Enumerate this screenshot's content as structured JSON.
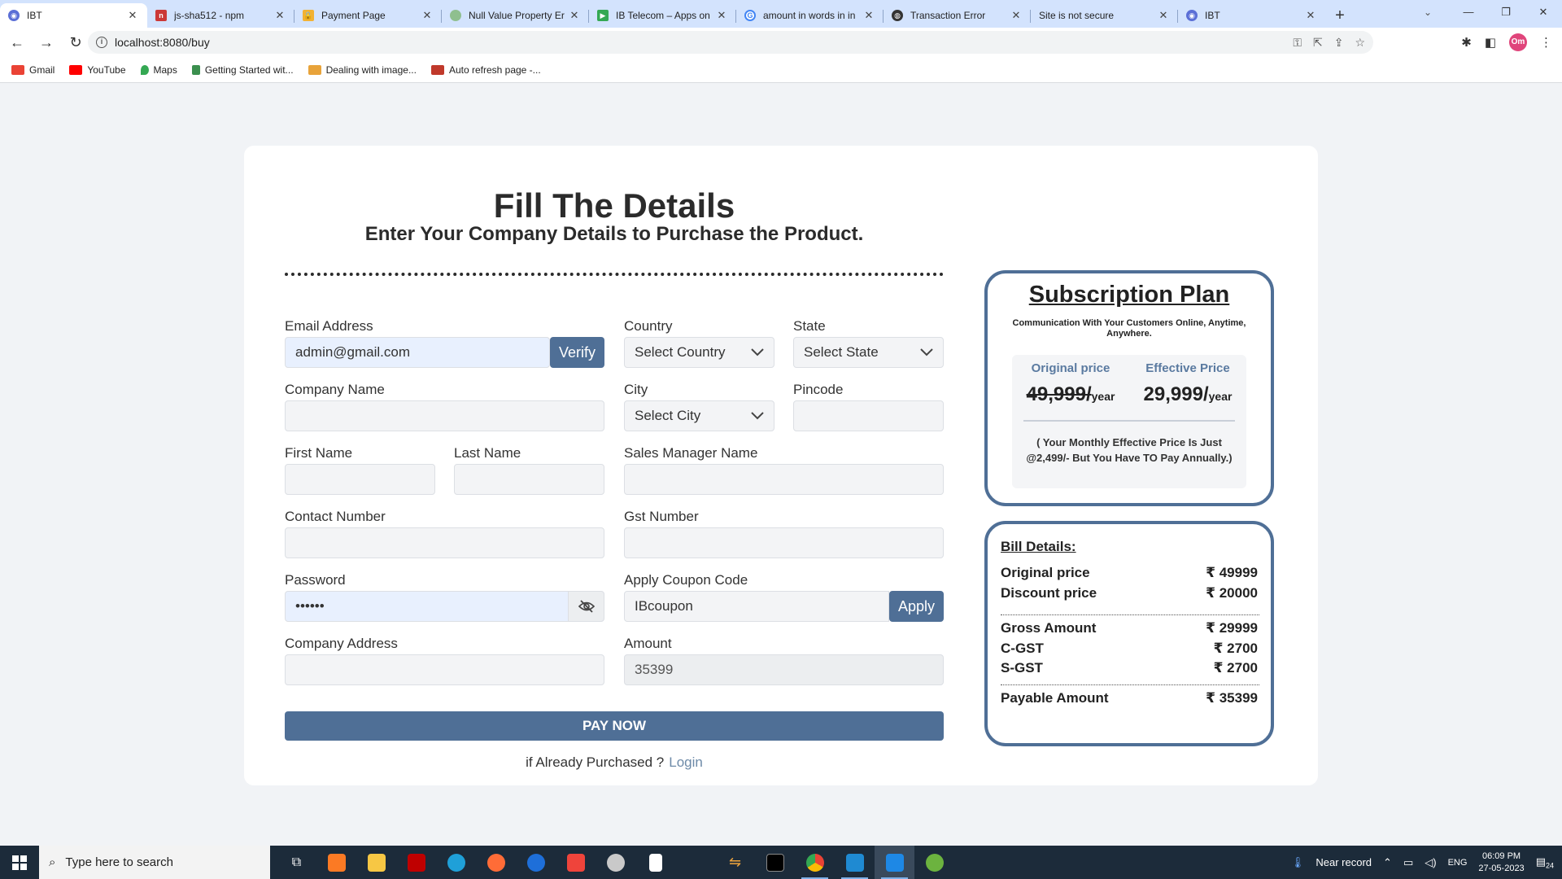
{
  "browser": {
    "tabs": [
      {
        "label": "IBT",
        "color": "#5b6fd6",
        "active": true
      },
      {
        "label": "js-sha512 - npm",
        "color": "#cb3837"
      },
      {
        "label": "Payment Page",
        "color": "#f2b233"
      },
      {
        "label": "Null Value Property Er",
        "color": "#8fbf8f"
      },
      {
        "label": "IB Telecom – Apps on",
        "color": "#34a853"
      },
      {
        "label": "amount in words in in",
        "color": "#4285f4"
      },
      {
        "label": "Transaction Error",
        "color": "#333333"
      },
      {
        "label": "Site is not secure",
        "color": "#999999"
      },
      {
        "label": "IBT",
        "color": "#5b6fd6"
      }
    ],
    "url": "localhost:8080/buy",
    "profile_initials": "Om",
    "bookmarks": [
      {
        "label": "Gmail",
        "color": "#ea4335"
      },
      {
        "label": "YouTube",
        "color": "#ff0000"
      },
      {
        "label": "Maps",
        "color": "#34a853"
      },
      {
        "label": "Getting Started wit...",
        "color": "#3b8f4e"
      },
      {
        "label": "Dealing with image...",
        "color": "#e8a33a"
      },
      {
        "label": "Auto refresh page -...",
        "color": "#c0392b"
      }
    ]
  },
  "page": {
    "title": "Fill The Details",
    "subtitle": "Enter Your Company Details to Purchase the Product.",
    "form": {
      "email_label": "Email Address",
      "email_value": "admin@gmail.com",
      "verify_label": "Verify",
      "country_label": "Country",
      "country_value": "Select Country",
      "state_label": "State",
      "state_value": "Select State",
      "company_label": "Company Name",
      "city_label": "City",
      "city_value": "Select City",
      "pincode_label": "Pincode",
      "first_name_label": "First Name",
      "last_name_label": "Last Name",
      "sales_manager_label": "Sales Manager Name",
      "contact_label": "Contact Number",
      "gst_label": "Gst Number",
      "password_label": "Password",
      "password_value": "••••••",
      "coupon_label": "Apply Coupon Code",
      "coupon_value": "IBcoupon",
      "apply_label": "Apply",
      "address_label": "Company Address",
      "amount_label": "Amount",
      "amount_value": "35399",
      "pay_label": "PAY NOW",
      "already_text": "if Already Purchased ?",
      "login_label": "Login"
    },
    "subscription": {
      "title": "Subscription Plan",
      "tagline": "Communication With Your Customers Online, Anytime, Anywhere.",
      "original_label": "Original price",
      "original_value": "49,999/",
      "effective_label": "Effective Price",
      "effective_value": "29,999/",
      "per": "year",
      "note": "( Your Monthly Effective Price Is Just @2,499/- But You Have TO Pay Annually.)"
    },
    "bill": {
      "title": "Bill Details:",
      "rows": [
        {
          "label": "Original price",
          "value": "₹ 49999"
        },
        {
          "label": "Discount price",
          "value": "₹ 20000"
        },
        {
          "label": "Gross Amount",
          "value": "₹ 29999"
        },
        {
          "label": "C-GST",
          "value": "₹ 2700"
        },
        {
          "label": "S-GST",
          "value": "₹ 2700"
        },
        {
          "label": "Payable Amount",
          "value": "₹ 35399"
        }
      ]
    }
  },
  "taskbar": {
    "search_placeholder": "Type here to search",
    "weather": "Near record",
    "lang": "ENG",
    "time": "06:09 PM",
    "date": "27-05-2023",
    "notifications": "24"
  }
}
